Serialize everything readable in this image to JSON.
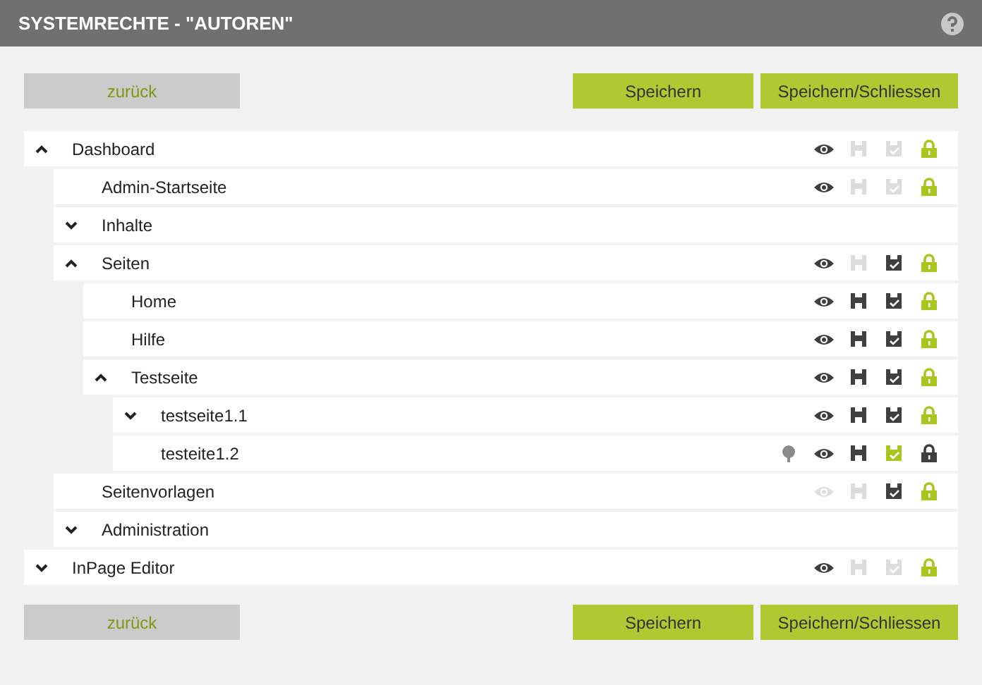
{
  "window": {
    "title": "SYSTEMRECHTE - \"AUTOREN\""
  },
  "top_buttons": [
    {
      "label": "zurück",
      "disabled": true
    },
    {
      "label": "Speichern",
      "disabled": false
    },
    {
      "label": "Speichern/Schliessen",
      "disabled": false
    }
  ],
  "tree": [
    {
      "label": "Dashboard",
      "expanded": true,
      "perms": [
        {
          "kind": "view",
          "color": "#3f3f3f"
        },
        {
          "kind": "edit",
          "color": "#dcdcdc"
        },
        {
          "kind": "publish",
          "color": "#dcdcdc"
        },
        {
          "kind": "lock",
          "color": "#a9c61f"
        }
      ],
      "children": [
        {
          "label": "Admin-Startseite",
          "perms": [
            {
              "kind": "view",
              "color": "#3f3f3f"
            },
            {
              "kind": "edit",
              "color": "#dcdcdc"
            },
            {
              "kind": "publish",
              "color": "#dcdcdc"
            },
            {
              "kind": "lock",
              "color": "#a9c61f"
            }
          ]
        },
        {
          "label": "Inhalte",
          "expanded": false
        },
        {
          "label": "Seiten",
          "expanded": true,
          "perms": [
            {
              "kind": "view",
              "color": "#3f3f3f"
            },
            {
              "kind": "edit",
              "color": "#dcdcdc"
            },
            {
              "kind": "publish",
              "color": "#3f3f3f"
            },
            {
              "kind": "lock",
              "color": "#a9c61f"
            }
          ],
          "children": [
            {
              "label": "Home",
              "perms": [
                {
                  "kind": "view",
                  "color": "#3f3f3f"
                },
                {
                  "kind": "edit",
                  "color": "#3f3f3f"
                },
                {
                  "kind": "publish",
                  "color": "#3f3f3f"
                },
                {
                  "kind": "lock",
                  "color": "#a9c61f"
                }
              ]
            },
            {
              "label": "Hilfe",
              "perms": [
                {
                  "kind": "view",
                  "color": "#3f3f3f"
                },
                {
                  "kind": "edit",
                  "color": "#3f3f3f"
                },
                {
                  "kind": "publish",
                  "color": "#3f3f3f"
                },
                {
                  "kind": "lock",
                  "color": "#a9c61f"
                }
              ]
            },
            {
              "label": "Testseite",
              "expanded": true,
              "perms": [
                {
                  "kind": "view",
                  "color": "#3f3f3f"
                },
                {
                  "kind": "edit",
                  "color": "#3f3f3f"
                },
                {
                  "kind": "publish",
                  "color": "#3f3f3f"
                },
                {
                  "kind": "lock",
                  "color": "#a9c61f"
                }
              ],
              "children": [
                {
                  "label": "testseite1.1",
                  "expanded": false,
                  "perms": [
                    {
                      "kind": "view",
                      "color": "#3f3f3f"
                    },
                    {
                      "kind": "edit",
                      "color": "#3f3f3f"
                    },
                    {
                      "kind": "publish",
                      "color": "#3f3f3f"
                    },
                    {
                      "kind": "lock",
                      "color": "#a9c61f"
                    }
                  ]
                },
                {
                  "label": "testeite1.2",
                  "perms": [
                    {
                      "kind": "tree",
                      "color": "#8a8a8a"
                    },
                    {
                      "kind": "view",
                      "color": "#3f3f3f"
                    },
                    {
                      "kind": "edit",
                      "color": "#3f3f3f"
                    },
                    {
                      "kind": "publish",
                      "color": "#a9c61f"
                    },
                    {
                      "kind": "lock",
                      "color": "#3f3f3f"
                    }
                  ]
                }
              ]
            }
          ]
        },
        {
          "label": "Seitenvorlagen",
          "perms": [
            {
              "kind": "view",
              "color": "#dcdcdc"
            },
            {
              "kind": "edit",
              "color": "#dcdcdc"
            },
            {
              "kind": "publish",
              "color": "#3f3f3f"
            },
            {
              "kind": "lock",
              "color": "#a9c61f"
            }
          ]
        },
        {
          "label": "Administration",
          "expanded": false
        }
      ]
    },
    {
      "label": "InPage Editor",
      "expanded": false,
      "perms": [
        {
          "kind": "view",
          "color": "#3f3f3f"
        },
        {
          "kind": "edit",
          "color": "#dcdcdc"
        },
        {
          "kind": "publish",
          "color": "#dcdcdc"
        },
        {
          "kind": "lock",
          "color": "#a9c61f"
        }
      ]
    }
  ],
  "bottom_buttons": [
    {
      "label": "zurück",
      "disabled": true
    },
    {
      "label": "Speichern",
      "disabled": false
    },
    {
      "label": "Speichern/Schliessen",
      "disabled": false
    }
  ]
}
